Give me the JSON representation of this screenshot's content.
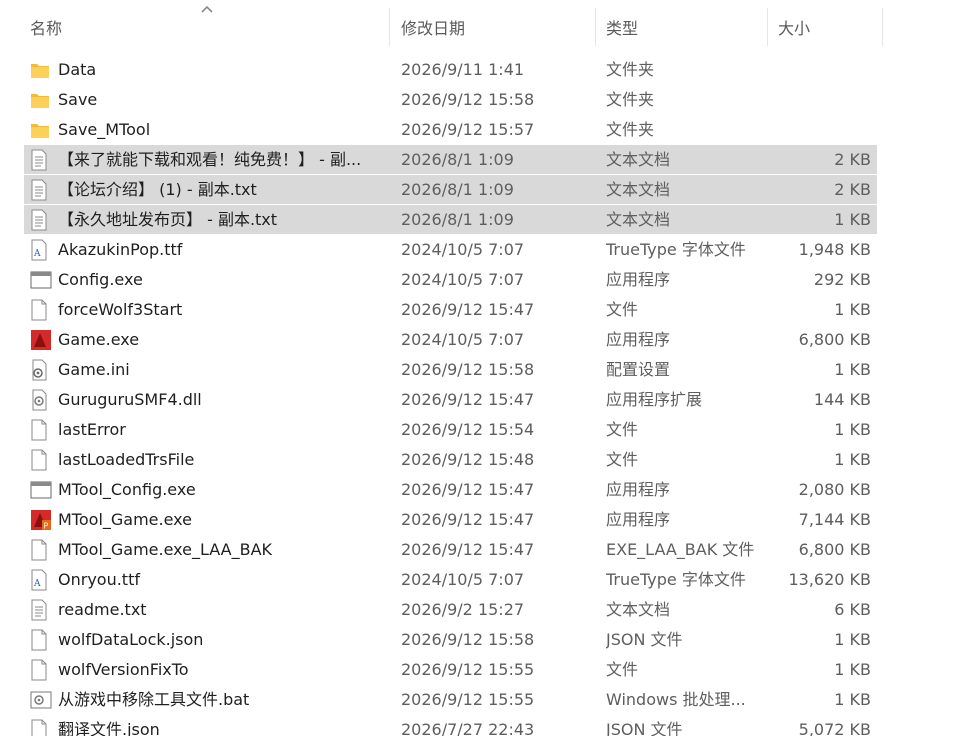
{
  "columns": {
    "name": "名称",
    "modified": "修改日期",
    "type": "类型",
    "size": "大小"
  },
  "files": [
    {
      "icon": "folder-icon",
      "name": "Data",
      "modified": "2026/9/11 1:41",
      "type": "文件夹",
      "size": "",
      "selected": false
    },
    {
      "icon": "folder-icon",
      "name": "Save",
      "modified": "2026/9/12 15:58",
      "type": "文件夹",
      "size": "",
      "selected": false
    },
    {
      "icon": "folder-icon",
      "name": "Save_MTool",
      "modified": "2026/9/12 15:57",
      "type": "文件夹",
      "size": "",
      "selected": false
    },
    {
      "icon": "text-document-icon",
      "name": "【来了就能下载和观看！纯免费！】 - 副...",
      "modified": "2026/8/1 1:09",
      "type": "文本文档",
      "size": "2 KB",
      "selected": true
    },
    {
      "icon": "text-document-icon",
      "name": "【论坛介绍】 (1) - 副本.txt",
      "modified": "2026/8/1 1:09",
      "type": "文本文档",
      "size": "2 KB",
      "selected": true
    },
    {
      "icon": "text-document-icon",
      "name": "【永久地址发布页】 - 副本.txt",
      "modified": "2026/8/1 1:09",
      "type": "文本文档",
      "size": "1 KB",
      "selected": true
    },
    {
      "icon": "font-file-icon",
      "name": "AkazukinPop.ttf",
      "modified": "2024/10/5 7:07",
      "type": "TrueType 字体文件",
      "size": "1,948 KB",
      "selected": false
    },
    {
      "icon": "application-window-icon",
      "name": "Config.exe",
      "modified": "2024/10/5 7:07",
      "type": "应用程序",
      "size": "292 KB",
      "selected": false
    },
    {
      "icon": "blank-file-icon",
      "name": "forceWolf3Start",
      "modified": "2026/9/12 15:47",
      "type": "文件",
      "size": "1 KB",
      "selected": false
    },
    {
      "icon": "game-app-icon",
      "name": "Game.exe",
      "modified": "2024/10/5 7:07",
      "type": "应用程序",
      "size": "6,800 KB",
      "selected": false
    },
    {
      "icon": "settings-file-icon",
      "name": "Game.ini",
      "modified": "2026/9/12 15:58",
      "type": "配置设置",
      "size": "1 KB",
      "selected": false
    },
    {
      "icon": "dll-gear-icon",
      "name": "GuruguruSMF4.dll",
      "modified": "2026/9/12 15:47",
      "type": "应用程序扩展",
      "size": "144 KB",
      "selected": false
    },
    {
      "icon": "blank-file-icon",
      "name": "lastError",
      "modified": "2026/9/12 15:54",
      "type": "文件",
      "size": "1 KB",
      "selected": false
    },
    {
      "icon": "blank-file-icon",
      "name": "lastLoadedTrsFile",
      "modified": "2026/9/12 15:48",
      "type": "文件",
      "size": "1 KB",
      "selected": false
    },
    {
      "icon": "application-window-icon",
      "name": "MTool_Config.exe",
      "modified": "2026/9/12 15:47",
      "type": "应用程序",
      "size": "2,080 KB",
      "selected": false
    },
    {
      "icon": "game-app-patched-icon",
      "name": "MTool_Game.exe",
      "modified": "2026/9/12 15:47",
      "type": "应用程序",
      "size": "7,144 KB",
      "selected": false
    },
    {
      "icon": "blank-file-icon",
      "name": "MTool_Game.exe_LAA_BAK",
      "modified": "2026/9/12 15:47",
      "type": "EXE_LAA_BAK 文件",
      "size": "6,800 KB",
      "selected": false
    },
    {
      "icon": "font-file-icon",
      "name": "Onryou.ttf",
      "modified": "2024/10/5 7:07",
      "type": "TrueType 字体文件",
      "size": "13,620 KB",
      "selected": false
    },
    {
      "icon": "text-document-icon",
      "name": "readme.txt",
      "modified": "2026/9/2 15:27",
      "type": "文本文档",
      "size": "6 KB",
      "selected": false
    },
    {
      "icon": "blank-file-icon",
      "name": "wolfDataLock.json",
      "modified": "2026/9/12 15:58",
      "type": "JSON 文件",
      "size": "1 KB",
      "selected": false
    },
    {
      "icon": "blank-file-icon",
      "name": "wolfVersionFixTo",
      "modified": "2026/9/12 15:55",
      "type": "文件",
      "size": "1 KB",
      "selected": false
    },
    {
      "icon": "batch-file-icon",
      "name": "从游戏中移除工具文件.bat",
      "modified": "2026/9/12 15:55",
      "type": "Windows 批处理...",
      "size": "1 KB",
      "selected": false
    },
    {
      "icon": "blank-file-icon",
      "name": "翻译文件.json",
      "modified": "2026/7/27 22:43",
      "type": "JSON 文件",
      "size": "5,072 KB",
      "selected": false
    }
  ],
  "colors": {
    "selection": "#d9d9d9",
    "folder": "#f8c84a",
    "text_secondary": "#5e5e5e",
    "game_red": "#d42a2a"
  }
}
